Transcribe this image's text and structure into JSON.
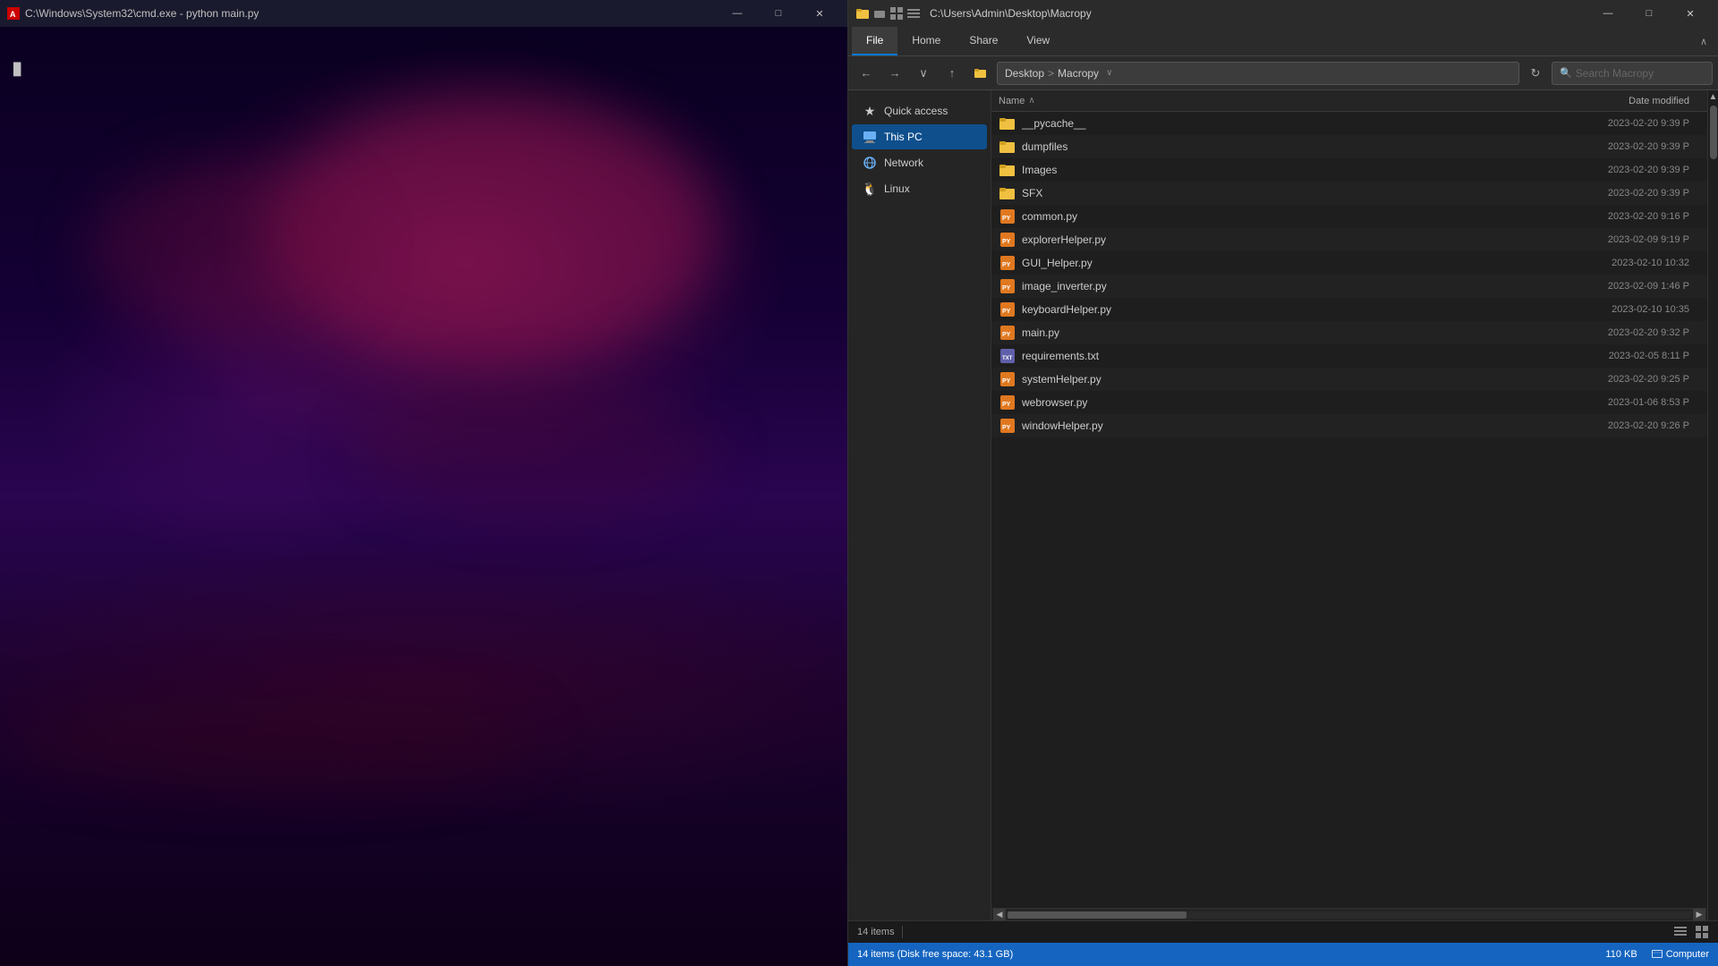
{
  "cmd": {
    "titlebar": {
      "title": "C:\\Windows\\System32\\cmd.exe - python  main.py",
      "icon_label": "A"
    },
    "controls": {
      "minimize": "—",
      "maximize": "□",
      "close": "✕"
    },
    "cursor_char": "█"
  },
  "explorer": {
    "titlebar": {
      "path": "C:\\Users\\Admin\\Desktop\\Macropy",
      "minimize": "—",
      "maximize": "□",
      "close": "✕"
    },
    "ribbon": {
      "tabs": [
        "File",
        "Home",
        "Share",
        "View"
      ],
      "active_tab": "File",
      "expand_icon": "∧"
    },
    "address": {
      "back_icon": "←",
      "forward_icon": "→",
      "dropdown_icon": "∨",
      "up_icon": "↑",
      "breadcrumb_parts": [
        "Desktop",
        ">",
        "Macropy"
      ],
      "refresh_icon": "↻",
      "search_placeholder": "Search Macropy",
      "search_icon": "🔍"
    },
    "sidebar": {
      "items": [
        {
          "id": "quick-access",
          "label": "Quick access",
          "icon": "★",
          "active": false
        },
        {
          "id": "this-pc",
          "label": "This PC",
          "icon": "💻",
          "active": true
        },
        {
          "id": "network",
          "label": "Network",
          "icon": "🌐",
          "active": false
        },
        {
          "id": "linux",
          "label": "Linux",
          "icon": "🐧",
          "active": false
        }
      ]
    },
    "file_list": {
      "columns": {
        "name": "Name",
        "date": "Date modified",
        "sort_arrow": "∧"
      },
      "files": [
        {
          "name": "__pycache__",
          "type": "folder",
          "date": "2023-02-20 9:39 P"
        },
        {
          "name": "dumpfiles",
          "type": "folder",
          "date": "2023-02-20 9:39 P"
        },
        {
          "name": "Images",
          "type": "folder",
          "date": "2023-02-20 9:39 P"
        },
        {
          "name": "SFX",
          "type": "folder",
          "date": "2023-02-20 9:39 P"
        },
        {
          "name": "common.py",
          "type": "py",
          "date": "2023-02-20 9:16 P"
        },
        {
          "name": "explorerHelper.py",
          "type": "py",
          "date": "2023-02-09 9:19 P"
        },
        {
          "name": "GUI_Helper.py",
          "type": "py",
          "date": "2023-02-10 10:32"
        },
        {
          "name": "image_inverter.py",
          "type": "py",
          "date": "2023-02-09 1:46 P"
        },
        {
          "name": "keyboardHelper.py",
          "type": "py",
          "date": "2023-02-10 10:35"
        },
        {
          "name": "main.py",
          "type": "py",
          "date": "2023-02-20 9:32 P"
        },
        {
          "name": "requirements.txt",
          "type": "txt",
          "date": "2023-02-05 8:11 P"
        },
        {
          "name": "systemHelper.py",
          "type": "py",
          "date": "2023-02-20 9:25 P"
        },
        {
          "name": "webrowser.py",
          "type": "py",
          "date": "2023-01-06 8:53 P"
        },
        {
          "name": "windowHelper.py",
          "type": "py",
          "date": "2023-02-20 9:26 P"
        }
      ]
    },
    "status": {
      "item_count": "14 items",
      "divider": "|",
      "size": "110 KB",
      "location": "Computer"
    },
    "info_bar": {
      "text": "14 items (Disk free space: 43.1 GB)",
      "size": "110 KB",
      "location": "Computer"
    }
  }
}
